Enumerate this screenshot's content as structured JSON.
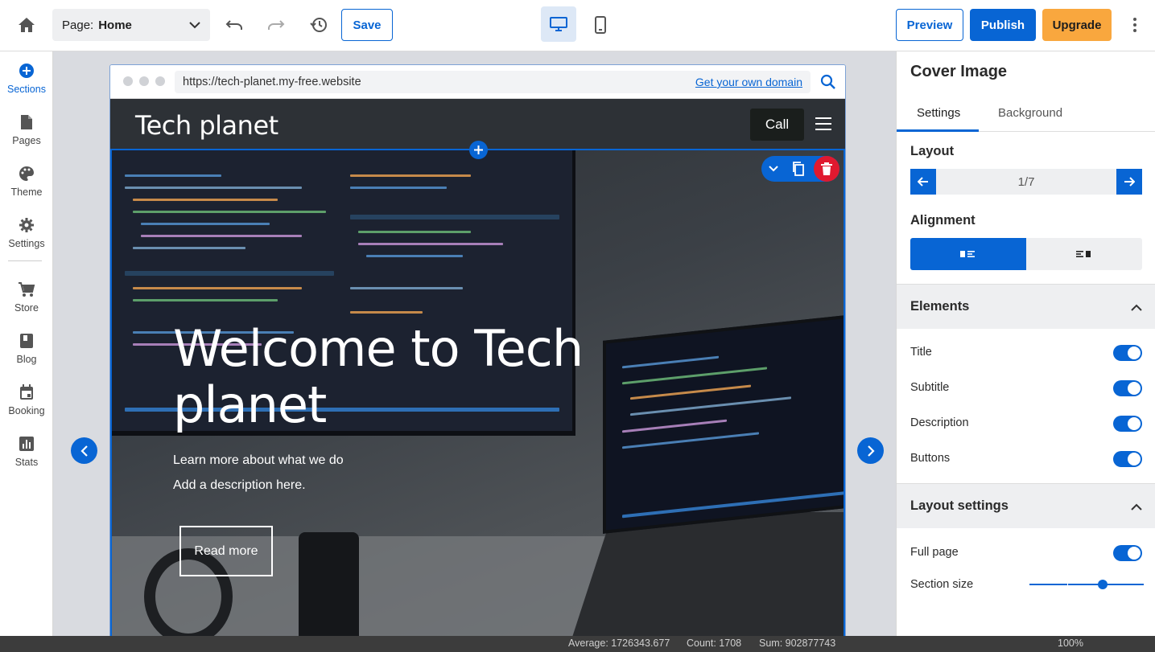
{
  "topbar": {
    "page_label": "Page:",
    "page_value": "Home",
    "save_label": "Save",
    "preview_label": "Preview",
    "publish_label": "Publish",
    "upgrade_label": "Upgrade",
    "device_selected": "desktop"
  },
  "sidebar": {
    "items": [
      {
        "label": "Sections",
        "icon": "plus-circle-icon"
      },
      {
        "label": "Pages",
        "icon": "page-icon"
      },
      {
        "label": "Theme",
        "icon": "palette-icon"
      },
      {
        "label": "Settings",
        "icon": "gear-icon"
      },
      {
        "label": "Store",
        "icon": "cart-icon"
      },
      {
        "label": "Blog",
        "icon": "book-icon"
      },
      {
        "label": "Booking",
        "icon": "calendar-icon"
      },
      {
        "label": "Stats",
        "icon": "chart-icon"
      }
    ]
  },
  "preview": {
    "url": "https://tech-planet.my-free.website",
    "domain_link": "Get your own domain",
    "site_title": "Tech planet",
    "call_label": "Call",
    "hero_title": "Welcome to Tech planet",
    "hero_subtitle": "Learn more about what we do",
    "hero_description": "Add a description here.",
    "hero_button": "Read more"
  },
  "panel": {
    "title": "Cover Image",
    "tabs": [
      "Settings",
      "Background"
    ],
    "layout_heading": "Layout",
    "layout_value": "1/7",
    "alignment_heading": "Alignment",
    "elements_heading": "Elements",
    "elements": [
      {
        "label": "Title",
        "on": true
      },
      {
        "label": "Subtitle",
        "on": true
      },
      {
        "label": "Description",
        "on": true
      },
      {
        "label": "Buttons",
        "on": true
      }
    ],
    "layout_settings_heading": "Layout settings",
    "full_page_label": "Full page",
    "section_size_label": "Section size",
    "section_size_fraction": 0.64
  },
  "statusbar": {
    "average": "Average: 1726343.677",
    "count": "Count: 1708",
    "sum": "Sum: 902877743",
    "zoom": "100%"
  },
  "colors": {
    "accent": "#0865d4",
    "upgrade": "#f9a73e",
    "delete": "#e0192f"
  }
}
